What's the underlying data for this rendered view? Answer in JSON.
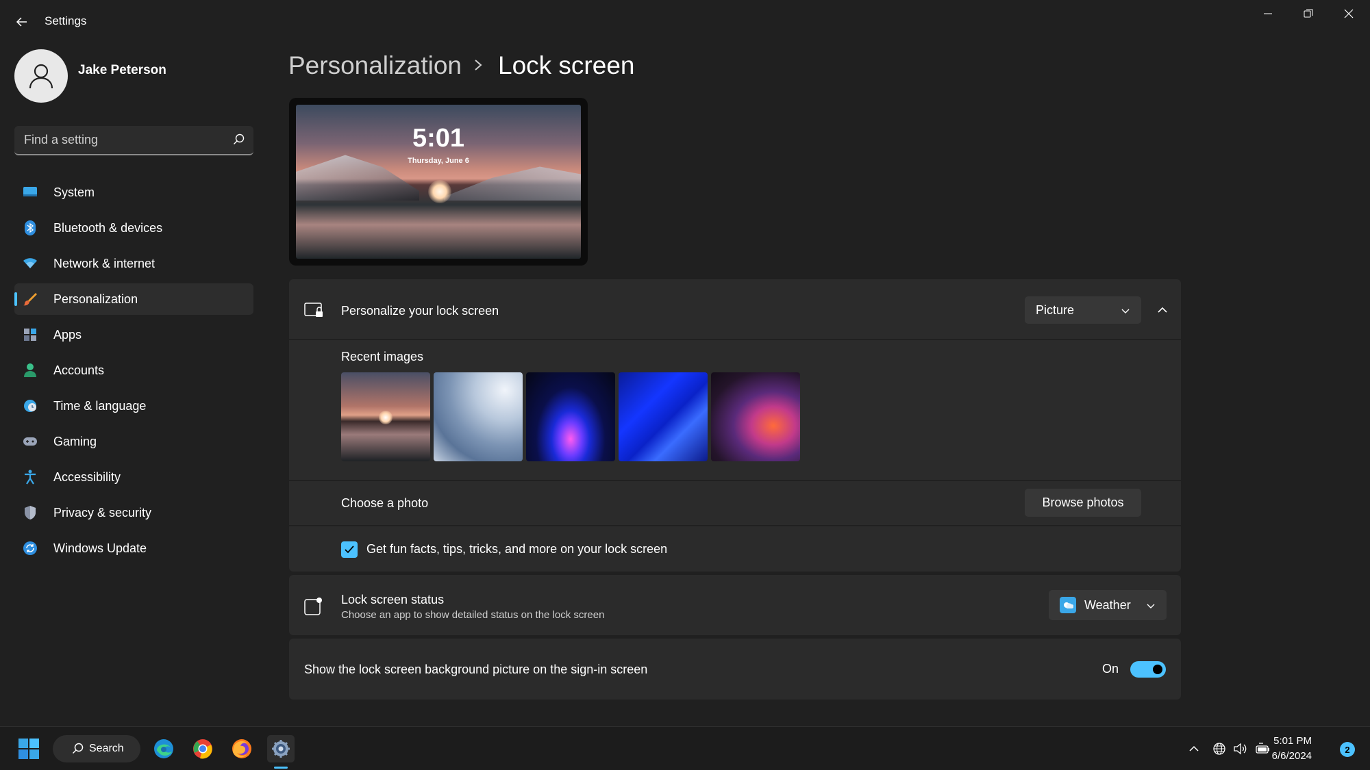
{
  "window": {
    "title": "Settings"
  },
  "user": {
    "name": "Jake Peterson"
  },
  "search": {
    "placeholder": "Find a setting"
  },
  "sidebar": {
    "items": [
      {
        "label": "System",
        "icon": "system-icon",
        "selected": false
      },
      {
        "label": "Bluetooth & devices",
        "icon": "bluetooth-icon",
        "selected": false
      },
      {
        "label": "Network & internet",
        "icon": "wifi-icon",
        "selected": false
      },
      {
        "label": "Personalization",
        "icon": "brush-icon",
        "selected": true
      },
      {
        "label": "Apps",
        "icon": "apps-icon",
        "selected": false
      },
      {
        "label": "Accounts",
        "icon": "accounts-icon",
        "selected": false
      },
      {
        "label": "Time & language",
        "icon": "time-language-icon",
        "selected": false
      },
      {
        "label": "Gaming",
        "icon": "gamepad-icon",
        "selected": false
      },
      {
        "label": "Accessibility",
        "icon": "accessibility-icon",
        "selected": false
      },
      {
        "label": "Privacy & security",
        "icon": "shield-icon",
        "selected": false
      },
      {
        "label": "Windows Update",
        "icon": "update-icon",
        "selected": false
      }
    ]
  },
  "breadcrumb": {
    "parent": "Personalization",
    "current": "Lock screen"
  },
  "preview": {
    "time": "5:01",
    "date": "Thursday, June 6"
  },
  "personalize": {
    "title": "Personalize your lock screen",
    "selected_option": "Picture",
    "recent_images_label": "Recent images",
    "choose_photo_label": "Choose a photo",
    "browse_button": "Browse photos",
    "tips_label": "Get fun facts, tips, tricks, and more on your lock screen",
    "tips_checked": true
  },
  "status": {
    "title": "Lock screen status",
    "subtitle": "Choose an app to show detailed status on the lock screen",
    "selected_app": "Weather"
  },
  "signin": {
    "label": "Show the lock screen background picture on the sign-in screen",
    "state_label": "On",
    "enabled": true
  },
  "taskbar": {
    "search_label": "Search",
    "time": "5:01 PM",
    "date": "6/6/2024",
    "notification_count": "2"
  },
  "colors": {
    "accent": "#4cc2ff",
    "background": "#202020",
    "card": "#2b2b2b"
  }
}
